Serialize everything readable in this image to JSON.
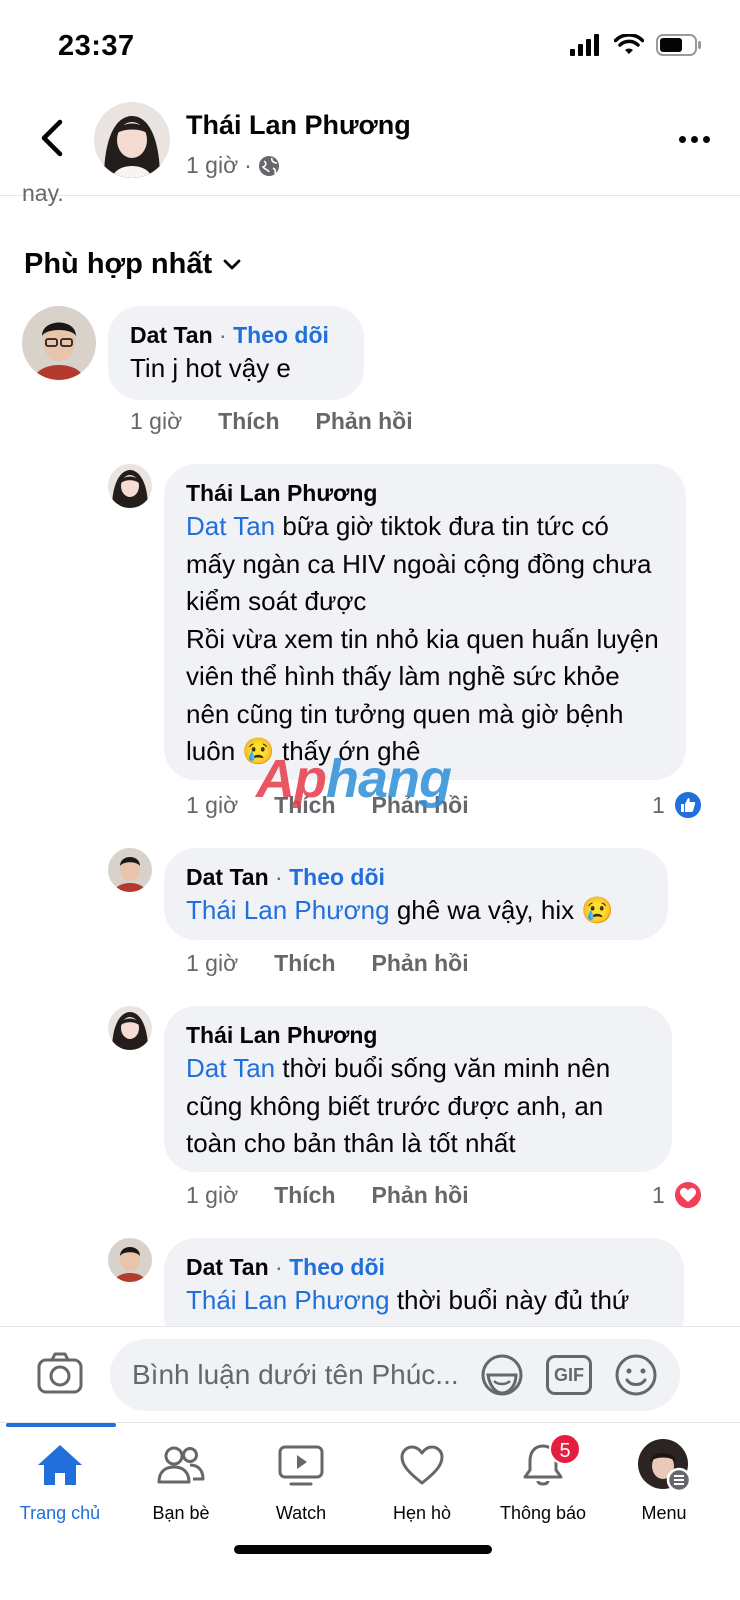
{
  "status_bar": {
    "time": "23:37"
  },
  "post_header": {
    "author": "Thái Lan Phương",
    "time": "1 giờ",
    "separator": "·"
  },
  "previous_text": "nay.",
  "sort": {
    "label": "Phù hợp nhất"
  },
  "comments": [
    {
      "author": "Dat Tan",
      "follow": "Theo dõi",
      "dot": " · ",
      "text": "Tin j hot vậy e",
      "time": "1 giờ",
      "like": "Thích",
      "reply": "Phản hồi"
    },
    {
      "author": "Thái Lan Phương",
      "mention": "Dat Tan",
      "text_1": " bữa giờ tiktok đưa tin tức có mấy ngàn ca HIV ngoài cộng đồng chưa kiểm soát được",
      "text_2": "Rồi vừa xem tin nhỏ kia quen huấn luyện viên thể hình thấy làm nghề sức khỏe nên cũng tin tưởng quen mà giờ bệnh luôn ",
      "emoji": "😢",
      "text_3": " thấy ớn ghê",
      "time": "1 giờ",
      "like": "Thích",
      "reply": "Phản hồi",
      "reaction_count": "1",
      "reaction_type": "like-icon"
    },
    {
      "author": "Dat Tan",
      "follow": "Theo dõi",
      "dot": " · ",
      "mention": "Thái Lan Phương",
      "text": " ghê wa vậy, hix ",
      "emoji": "😢",
      "time": "1 giờ",
      "like": "Thích",
      "reply": "Phản hồi"
    },
    {
      "author": "Thái Lan Phương",
      "mention": "Dat Tan",
      "text": " thời buổi sống văn minh nên cũng không biết trước được anh, an toàn cho bản thân là tốt nhất",
      "time": "1 giờ",
      "like": "Thích",
      "reply": "Phản hồi",
      "reaction_count": "1",
      "reaction_type": "heart-icon"
    },
    {
      "author": "Dat Tan",
      "follow": "Theo dõi",
      "dot": " · ",
      "mention": "Thái Lan Phương",
      "text": " thời buổi này đủ thứ"
    }
  ],
  "watermark": {
    "part_1": "Ap",
    "part_2": "hang"
  },
  "composer": {
    "placeholder": "Bình luận dưới tên Phúc...",
    "gif_label": "GIF"
  },
  "tabs": [
    {
      "label": "Trang chủ",
      "icon": "home-icon",
      "active": true
    },
    {
      "label": "Bạn bè",
      "icon": "friends-icon"
    },
    {
      "label": "Watch",
      "icon": "watch-icon"
    },
    {
      "label": "Hẹn hò",
      "icon": "dating-heart-icon"
    },
    {
      "label": "Thông báo",
      "icon": "bell-icon",
      "badge": "5"
    },
    {
      "label": "Menu",
      "icon": "menu-avatar-icon"
    }
  ],
  "colors": {
    "accent": "#216fdb",
    "bubble": "#f0f2f5",
    "muted": "#65676b",
    "badge": "#e41e3f"
  }
}
